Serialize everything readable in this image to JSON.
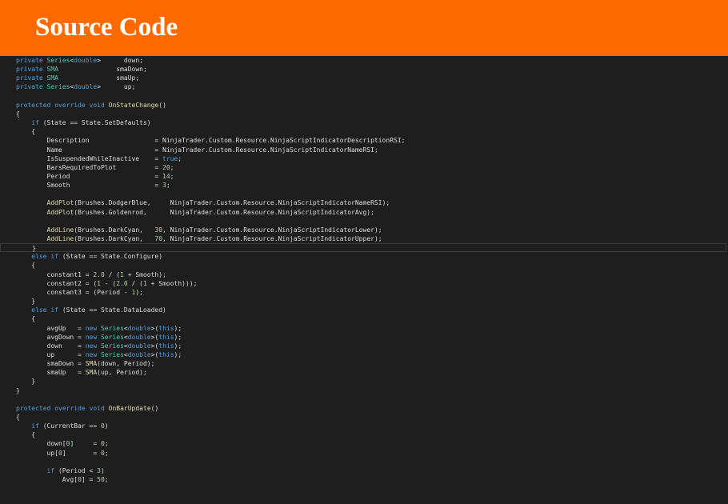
{
  "banner": {
    "title": "Source Code"
  },
  "code": {
    "colors": {
      "keyword": "#569cd6",
      "number": "#b5cea8",
      "type": "#4ec9b0",
      "text": "#dcdcdc",
      "background": "#1e1e1e",
      "banner": "#ff6a00"
    },
    "highlighted_line": 21,
    "lines": [
      [
        [
          "k",
          "private"
        ],
        [
          "t",
          " "
        ],
        [
          "y",
          "Series"
        ],
        [
          "t",
          "<"
        ],
        [
          "k",
          "double"
        ],
        [
          "t",
          ">      down;"
        ]
      ],
      [
        [
          "k",
          "private"
        ],
        [
          "t",
          " "
        ],
        [
          "y",
          "SMA"
        ],
        [
          "t",
          "               smaDown;"
        ]
      ],
      [
        [
          "k",
          "private"
        ],
        [
          "t",
          " "
        ],
        [
          "y",
          "SMA"
        ],
        [
          "t",
          "               smaUp;"
        ]
      ],
      [
        [
          "k",
          "private"
        ],
        [
          "t",
          " "
        ],
        [
          "y",
          "Series"
        ],
        [
          "t",
          "<"
        ],
        [
          "k",
          "double"
        ],
        [
          "t",
          ">      up;"
        ]
      ],
      [],
      [
        [
          "k",
          "protected"
        ],
        [
          "t",
          " "
        ],
        [
          "k",
          "override"
        ],
        [
          "t",
          " "
        ],
        [
          "k",
          "void"
        ],
        [
          "t",
          " "
        ],
        [
          "m",
          "OnStateChange"
        ],
        [
          "t",
          "()"
        ]
      ],
      [
        [
          "t",
          "{"
        ]
      ],
      [
        [
          "t",
          "    "
        ],
        [
          "k",
          "if"
        ],
        [
          "t",
          " (State == State.SetDefaults)"
        ]
      ],
      [
        [
          "t",
          "    {"
        ]
      ],
      [
        [
          "t",
          "        Description                 = NinjaTrader.Custom.Resource.NinjaScriptIndicatorDescriptionRSI;"
        ]
      ],
      [
        [
          "t",
          "        Name                        = NinjaTrader.Custom.Resource.NinjaScriptIndicatorNameRSI;"
        ]
      ],
      [
        [
          "t",
          "        IsSuspendedWhileInactive    = "
        ],
        [
          "k",
          "true"
        ],
        [
          "t",
          ";"
        ]
      ],
      [
        [
          "t",
          "        BarsRequiredToPlot          = "
        ],
        [
          "n",
          "20"
        ],
        [
          "t",
          ";"
        ]
      ],
      [
        [
          "t",
          "        Period                      = "
        ],
        [
          "n",
          "14"
        ],
        [
          "t",
          ";"
        ]
      ],
      [
        [
          "t",
          "        Smooth                      = "
        ],
        [
          "n",
          "3"
        ],
        [
          "t",
          ";"
        ]
      ],
      [],
      [
        [
          "t",
          "        "
        ],
        [
          "m",
          "AddPlot"
        ],
        [
          "t",
          "(Brushes.DodgerBlue,     NinjaTrader.Custom.Resource.NinjaScriptIndicatorNameRSI);"
        ]
      ],
      [
        [
          "t",
          "        "
        ],
        [
          "m",
          "AddPlot"
        ],
        [
          "t",
          "(Brushes.Goldenrod,      NinjaTrader.Custom.Resource.NinjaScriptIndicatorAvg);"
        ]
      ],
      [],
      [
        [
          "t",
          "        "
        ],
        [
          "m",
          "AddLine"
        ],
        [
          "t",
          "(Brushes.DarkCyan,   "
        ],
        [
          "n",
          "30"
        ],
        [
          "t",
          ", NinjaTrader.Custom.Resource.NinjaScriptIndicatorLower);"
        ]
      ],
      [
        [
          "t",
          "        "
        ],
        [
          "m",
          "AddLine"
        ],
        [
          "t",
          "(Brushes.DarkCyan,   "
        ],
        [
          "n",
          "70"
        ],
        [
          "t",
          ", NinjaTrader.Custom.Resource.NinjaScriptIndicatorUpper);"
        ]
      ],
      [
        [
          "t",
          "    }"
        ]
      ],
      [
        [
          "t",
          "    "
        ],
        [
          "k",
          "else"
        ],
        [
          "t",
          " "
        ],
        [
          "k",
          "if"
        ],
        [
          "t",
          " (State == State.Configure)"
        ]
      ],
      [
        [
          "t",
          "    {"
        ]
      ],
      [
        [
          "t",
          "        constant1 = "
        ],
        [
          "n",
          "2.0"
        ],
        [
          "t",
          " / ("
        ],
        [
          "n",
          "1"
        ],
        [
          "t",
          " + Smooth);"
        ]
      ],
      [
        [
          "t",
          "        constant2 = ("
        ],
        [
          "n",
          "1"
        ],
        [
          "t",
          " - ("
        ],
        [
          "n",
          "2.0"
        ],
        [
          "t",
          " / ("
        ],
        [
          "n",
          "1"
        ],
        [
          "t",
          " + Smooth)));"
        ]
      ],
      [
        [
          "t",
          "        constant3 = (Period - "
        ],
        [
          "n",
          "1"
        ],
        [
          "t",
          ");"
        ]
      ],
      [
        [
          "t",
          "    }"
        ]
      ],
      [
        [
          "t",
          "    "
        ],
        [
          "k",
          "else"
        ],
        [
          "t",
          " "
        ],
        [
          "k",
          "if"
        ],
        [
          "t",
          " (State == State.DataLoaded)"
        ]
      ],
      [
        [
          "t",
          "    {"
        ]
      ],
      [
        [
          "t",
          "        avgUp   = "
        ],
        [
          "k",
          "new"
        ],
        [
          "t",
          " "
        ],
        [
          "y",
          "Series"
        ],
        [
          "t",
          "<"
        ],
        [
          "k",
          "double"
        ],
        [
          "t",
          ">("
        ],
        [
          "k",
          "this"
        ],
        [
          "t",
          ");"
        ]
      ],
      [
        [
          "t",
          "        avgDown = "
        ],
        [
          "k",
          "new"
        ],
        [
          "t",
          " "
        ],
        [
          "y",
          "Series"
        ],
        [
          "t",
          "<"
        ],
        [
          "k",
          "double"
        ],
        [
          "t",
          ">("
        ],
        [
          "k",
          "this"
        ],
        [
          "t",
          ");"
        ]
      ],
      [
        [
          "t",
          "        down    = "
        ],
        [
          "k",
          "new"
        ],
        [
          "t",
          " "
        ],
        [
          "y",
          "Series"
        ],
        [
          "t",
          "<"
        ],
        [
          "k",
          "double"
        ],
        [
          "t",
          ">("
        ],
        [
          "k",
          "this"
        ],
        [
          "t",
          ");"
        ]
      ],
      [
        [
          "t",
          "        up      = "
        ],
        [
          "k",
          "new"
        ],
        [
          "t",
          " "
        ],
        [
          "y",
          "Series"
        ],
        [
          "t",
          "<"
        ],
        [
          "k",
          "double"
        ],
        [
          "t",
          ">("
        ],
        [
          "k",
          "this"
        ],
        [
          "t",
          ");"
        ]
      ],
      [
        [
          "t",
          "        smaDown = "
        ],
        [
          "m",
          "SMA"
        ],
        [
          "t",
          "(down, Period);"
        ]
      ],
      [
        [
          "t",
          "        smaUp   = "
        ],
        [
          "m",
          "SMA"
        ],
        [
          "t",
          "(up, Period);"
        ]
      ],
      [
        [
          "t",
          "    }"
        ]
      ],
      [
        [
          "t",
          "}"
        ]
      ],
      [],
      [
        [
          "k",
          "protected"
        ],
        [
          "t",
          " "
        ],
        [
          "k",
          "override"
        ],
        [
          "t",
          " "
        ],
        [
          "k",
          "void"
        ],
        [
          "t",
          " "
        ],
        [
          "m",
          "OnBarUpdate"
        ],
        [
          "t",
          "()"
        ]
      ],
      [
        [
          "t",
          "{"
        ]
      ],
      [
        [
          "t",
          "    "
        ],
        [
          "k",
          "if"
        ],
        [
          "t",
          " (CurrentBar == "
        ],
        [
          "n",
          "0"
        ],
        [
          "t",
          ")"
        ]
      ],
      [
        [
          "t",
          "    {"
        ]
      ],
      [
        [
          "t",
          "        down["
        ],
        [
          "n",
          "0"
        ],
        [
          "t",
          "]     = "
        ],
        [
          "n",
          "0"
        ],
        [
          "t",
          ";"
        ]
      ],
      [
        [
          "t",
          "        up["
        ],
        [
          "n",
          "0"
        ],
        [
          "t",
          "]       = "
        ],
        [
          "n",
          "0"
        ],
        [
          "t",
          ";"
        ]
      ],
      [],
      [
        [
          "t",
          "        "
        ],
        [
          "k",
          "if"
        ],
        [
          "t",
          " (Period < "
        ],
        [
          "n",
          "3"
        ],
        [
          "t",
          ")"
        ]
      ],
      [
        [
          "t",
          "            Avg["
        ],
        [
          "n",
          "0"
        ],
        [
          "t",
          "] = "
        ],
        [
          "n",
          "50"
        ],
        [
          "t",
          ";"
        ]
      ]
    ]
  }
}
